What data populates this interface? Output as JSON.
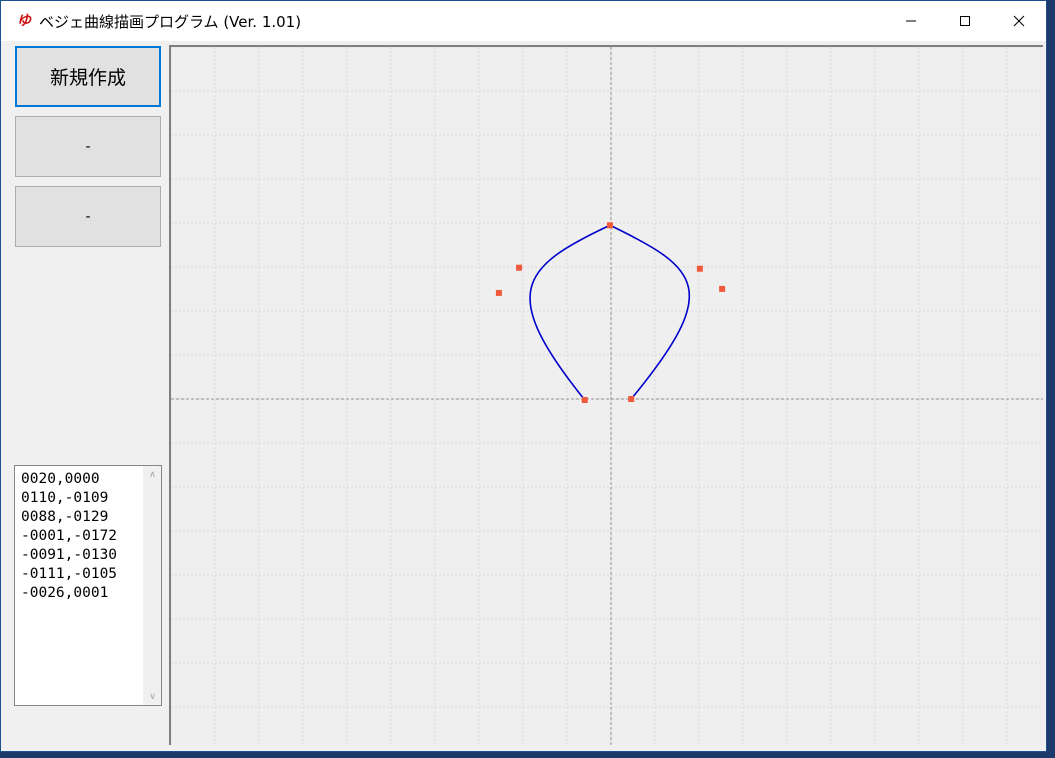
{
  "window": {
    "title": "ベジェ曲線描画プログラム (Ver. 1.01)",
    "icon": "bezier-app-icon",
    "controls": {
      "minimize": "—",
      "maximize": "☐",
      "close": "✕"
    }
  },
  "sidebar": {
    "new_button_label": "新規作成",
    "button2_label": "-",
    "button3_label": "-"
  },
  "points_list": {
    "items": [
      "0020,0000",
      "0110,-0109",
      "0088,-0129",
      "-0001,-0172",
      "-0091,-0130",
      "-0111,-0105",
      "-0026,0001"
    ]
  },
  "canvas": {
    "background": "#efefef",
    "grid_color": "#d8d8d8",
    "axis_color": "#909090",
    "curve_color": "#0000cc",
    "point_color": "#f05a3c",
    "grid_step": 44,
    "control_points": [
      [
        20,
        0
      ],
      [
        110,
        -109
      ],
      [
        88,
        -129
      ],
      [
        -1,
        -172
      ],
      [
        -91,
        -130
      ],
      [
        -111,
        -105
      ],
      [
        -26,
        1
      ]
    ]
  }
}
